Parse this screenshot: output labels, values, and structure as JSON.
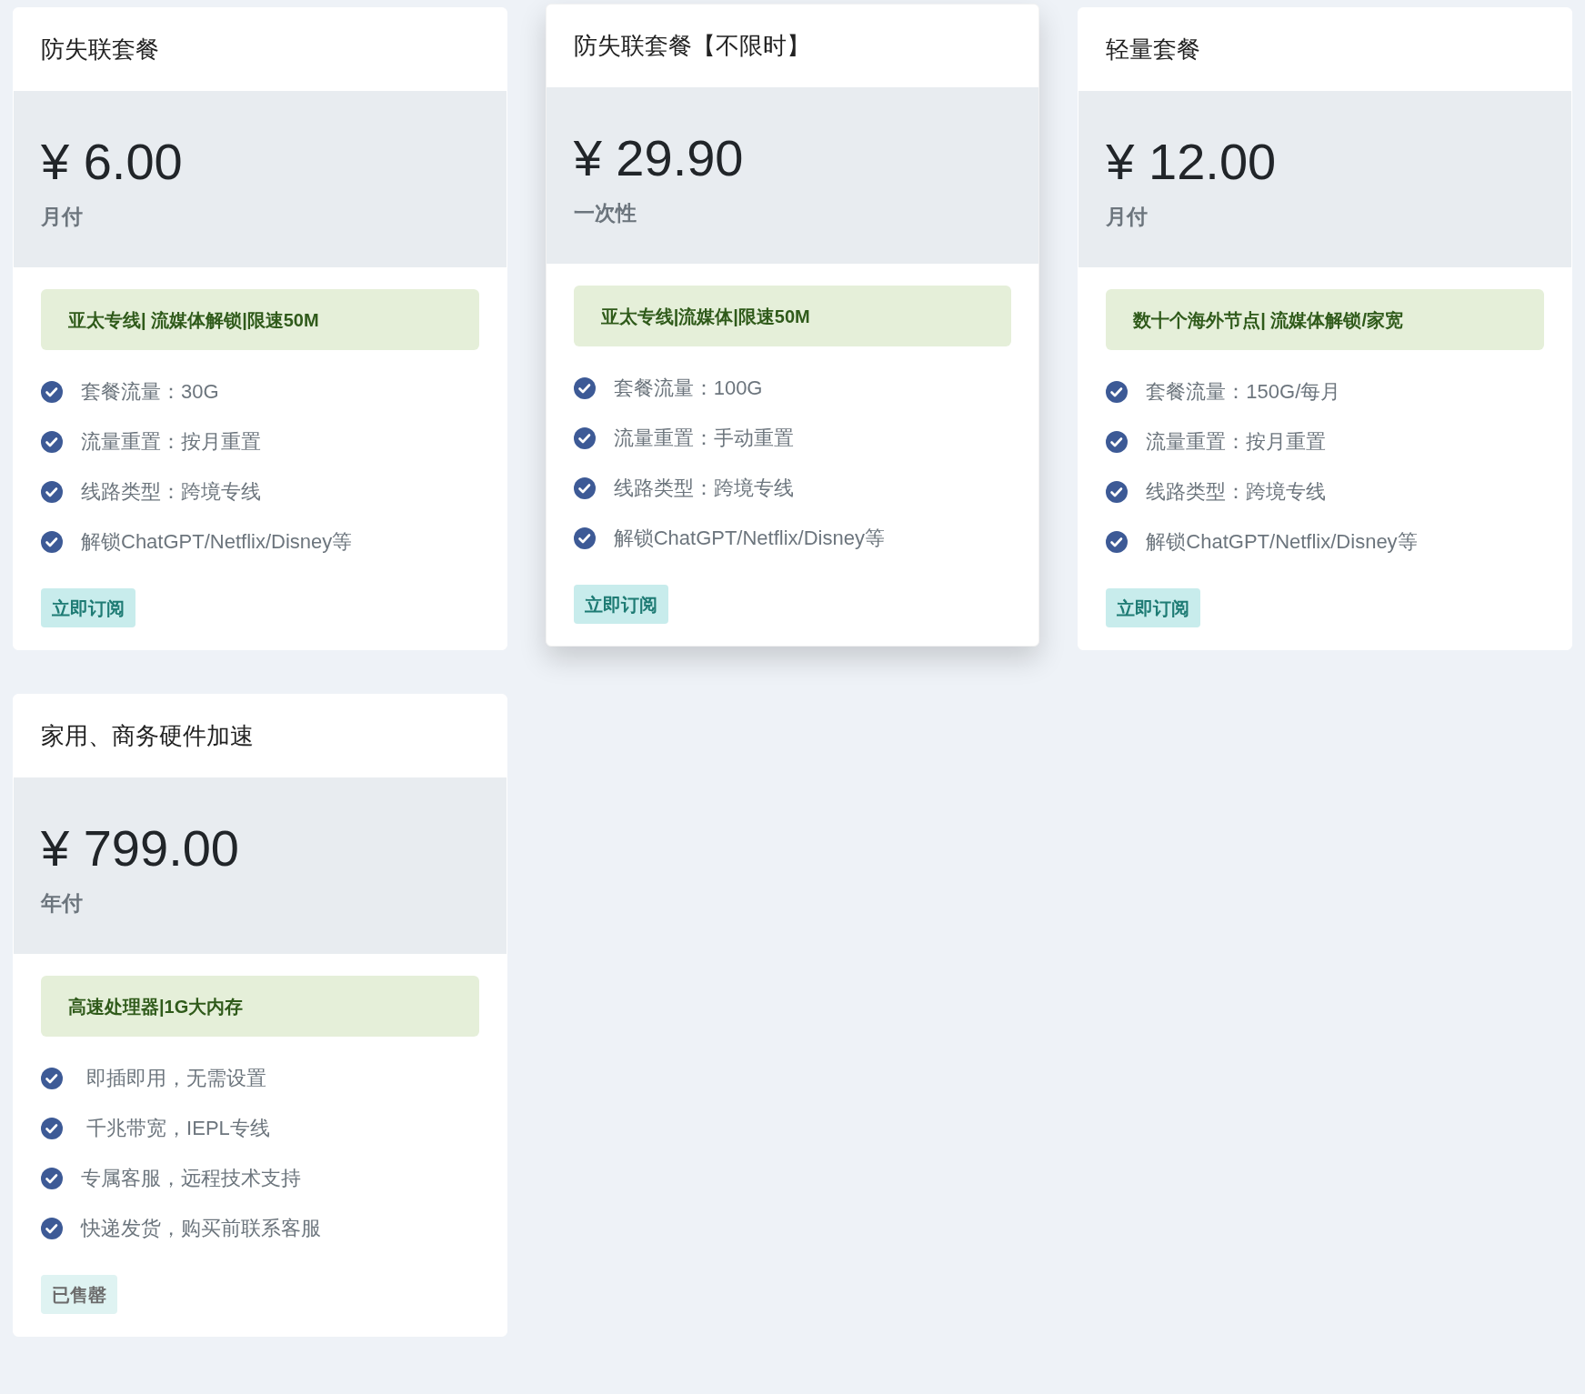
{
  "plans": [
    {
      "title": "防失联套餐",
      "raised": false,
      "price": "¥ 6.00",
      "period": "月付",
      "tag": "亚太专线| 流媒体解锁|限速50M",
      "features": [
        "套餐流量：30G",
        "流量重置：按月重置",
        "线路类型：跨境专线",
        "解锁ChatGPT/Netflix/Disney等"
      ],
      "button": {
        "label": "立即订阅",
        "disabled": false
      }
    },
    {
      "title": "防失联套餐【不限时】",
      "raised": true,
      "price": "¥ 29.90",
      "period": "一次性",
      "tag": "亚太专线|流媒体|限速50M",
      "features": [
        "套餐流量：100G",
        "流量重置：手动重置",
        "线路类型：跨境专线",
        "解锁ChatGPT/Netflix/Disney等"
      ],
      "button": {
        "label": "立即订阅",
        "disabled": false
      }
    },
    {
      "title": "轻量套餐",
      "raised": false,
      "price": "¥ 12.00",
      "period": "月付",
      "tag": "数十个海外节点| 流媒体解锁/家宽",
      "features": [
        "套餐流量：150G/每月",
        "流量重置：按月重置",
        "线路类型：跨境专线",
        "解锁ChatGPT/Netflix/Disney等"
      ],
      "button": {
        "label": "立即订阅",
        "disabled": false
      }
    },
    {
      "title": "家用、商务硬件加速",
      "raised": false,
      "price": "¥ 799.00",
      "period": "年付",
      "tag": "高速处理器|1G大内存",
      "features": [
        " 即插即用，无需设置",
        " 千兆带宽，IEPL专线",
        "专属客服，远程技术支持",
        "快递发货，购买前联系客服"
      ],
      "button": {
        "label": "已售罄",
        "disabled": true
      }
    }
  ]
}
